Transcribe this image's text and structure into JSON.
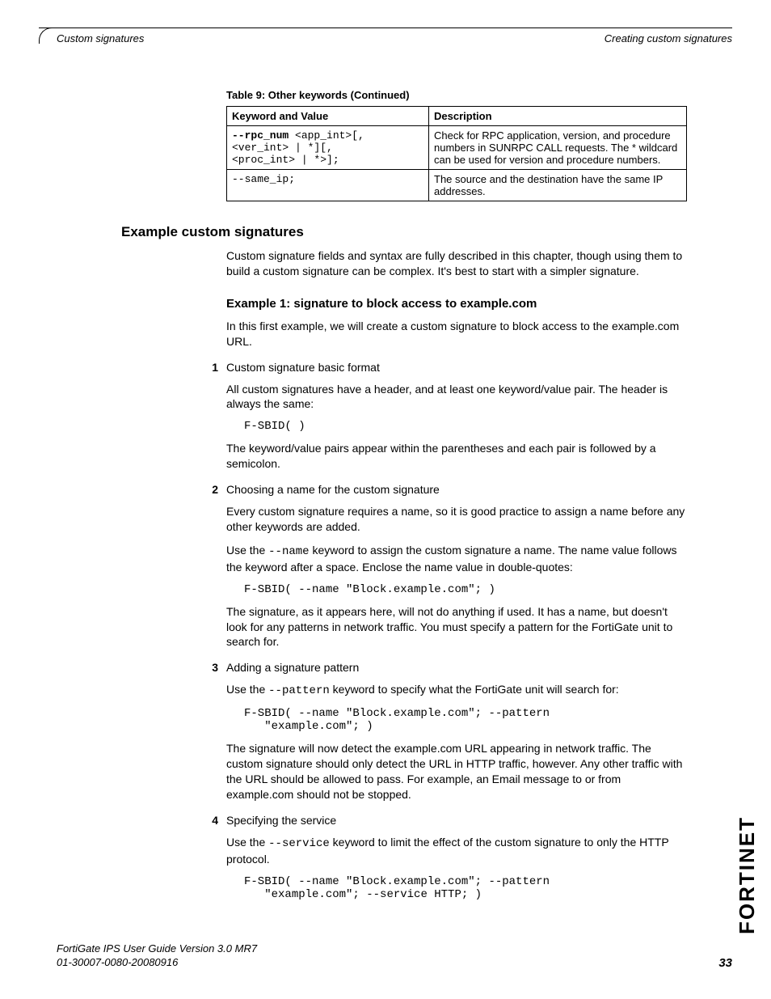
{
  "header": {
    "left": "Custom signatures",
    "right": "Creating custom signatures"
  },
  "table": {
    "caption": "Table 9: Other keywords (Continued)",
    "col1": "Keyword and Value",
    "col2": "Description",
    "rows": [
      {
        "kw_bold": "--rpc_num",
        "kw_rest1": " <app_int>[,",
        "kw_line2": "<ver_int> | *][,",
        "kw_line3": "<proc_int> | *>];",
        "desc": "Check for RPC application, version, and procedure numbers in SUNRPC CALL requests. The * wildcard can be used for version and procedure numbers."
      },
      {
        "kw": "--same_ip;",
        "desc": "The source and the destination have the same IP addresses."
      }
    ]
  },
  "section_title": "Example custom signatures",
  "intro": "Custom signature fields and syntax are fully described in this chapter, though using them to build a custom signature can be complex. It's best to start with a simpler signature.",
  "example_title": "Example 1: signature to block access to example.com",
  "example_intro": "In this first example, we will create a custom signature to block access to the example.com URL.",
  "steps": {
    "s1": {
      "num": "1",
      "title": "Custom signature basic format",
      "p1": "All custom signatures have a header, and at least one keyword/value pair. The header is always the same:",
      "code1": "F-SBID( )",
      "p2": "The keyword/value pairs appear within the parentheses and each pair is followed by a semicolon."
    },
    "s2": {
      "num": "2",
      "title": "Choosing a name for the custom signature",
      "p1": "Every custom signature requires a name, so it is good practice to assign a name before any other keywords are added.",
      "p2a": "Use the ",
      "p2code": "--name",
      "p2b": " keyword to assign the custom signature a name. The name value follows the keyword after a space. Enclose the name value in double-quotes:",
      "code1": "F-SBID( --name \"Block.example.com\"; )",
      "p3": "The signature, as it appears here, will not do anything if used. It has a name, but doesn't look for any patterns in network traffic. You must specify a pattern for the FortiGate unit to search for."
    },
    "s3": {
      "num": "3",
      "title": "Adding a signature pattern",
      "p1a": "Use the ",
      "p1code": "--pattern",
      "p1b": " keyword to specify what the FortiGate unit will search for:",
      "code1": "F-SBID( --name \"Block.example.com\"; --pattern\n   \"example.com\"; )",
      "p2": "The signature will now detect the example.com URL appearing in network traffic. The custom signature should only detect the URL in HTTP traffic, however. Any other traffic with the URL should be allowed to pass. For example, an Email message to or from example.com should not be stopped."
    },
    "s4": {
      "num": "4",
      "title": "Specifying the service",
      "p1a": "Use the ",
      "p1code": "--service",
      "p1b": " keyword to limit the effect of the custom signature to only the HTTP protocol.",
      "code1": "F-SBID( --name \"Block.example.com\"; --pattern\n   \"example.com\"; --service HTTP; )"
    }
  },
  "footer": {
    "line1": "FortiGate IPS User Guide Version 3.0 MR7",
    "line2": "01-30007-0080-20080916",
    "page": "33"
  },
  "logo": "FORTINET"
}
